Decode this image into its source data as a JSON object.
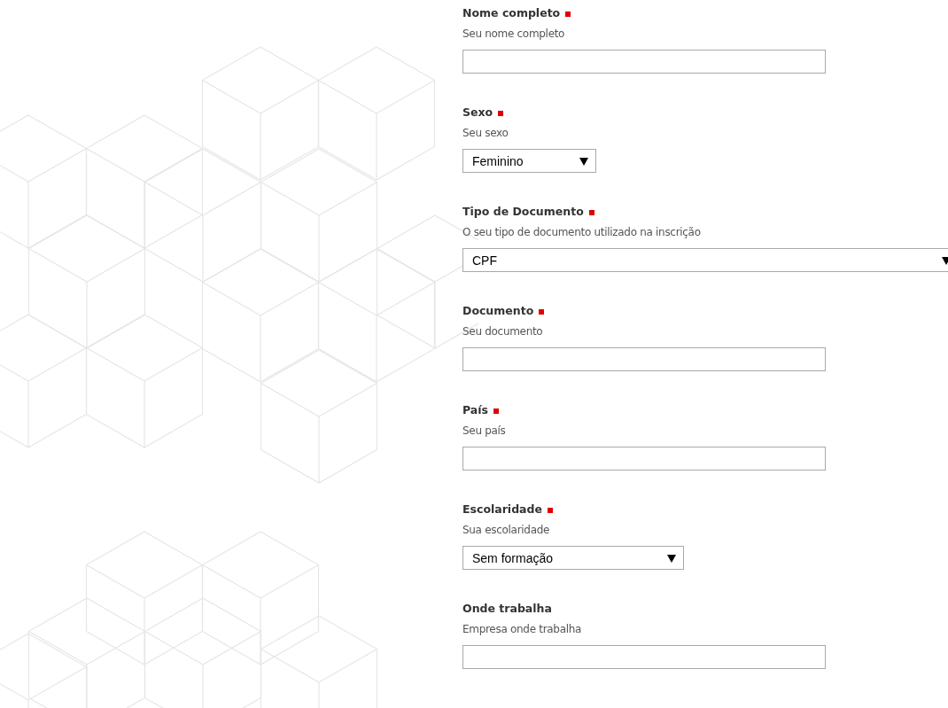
{
  "form": {
    "fields": [
      {
        "label": "Nome completo",
        "required": true,
        "hint": "Seu nome completo",
        "kind": "text"
      },
      {
        "label": "Sexo",
        "required": true,
        "hint": "Seu sexo",
        "kind": "select",
        "value": "Feminino"
      },
      {
        "label": "Tipo de Documento",
        "required": true,
        "hint": "O seu tipo de documento utilizado na inscrição",
        "kind": "select",
        "value": "CPF"
      },
      {
        "label": "Documento",
        "required": true,
        "hint": "Seu documento",
        "kind": "text"
      },
      {
        "label": "País",
        "required": true,
        "hint": "Seu país",
        "kind": "text"
      },
      {
        "label": "Escolaridade",
        "required": true,
        "hint": "Sua escolaridade",
        "kind": "select",
        "value": "Sem formação"
      },
      {
        "label": "Onde trabalha",
        "required": false,
        "hint": "Empresa onde trabalha",
        "kind": "text"
      }
    ]
  }
}
